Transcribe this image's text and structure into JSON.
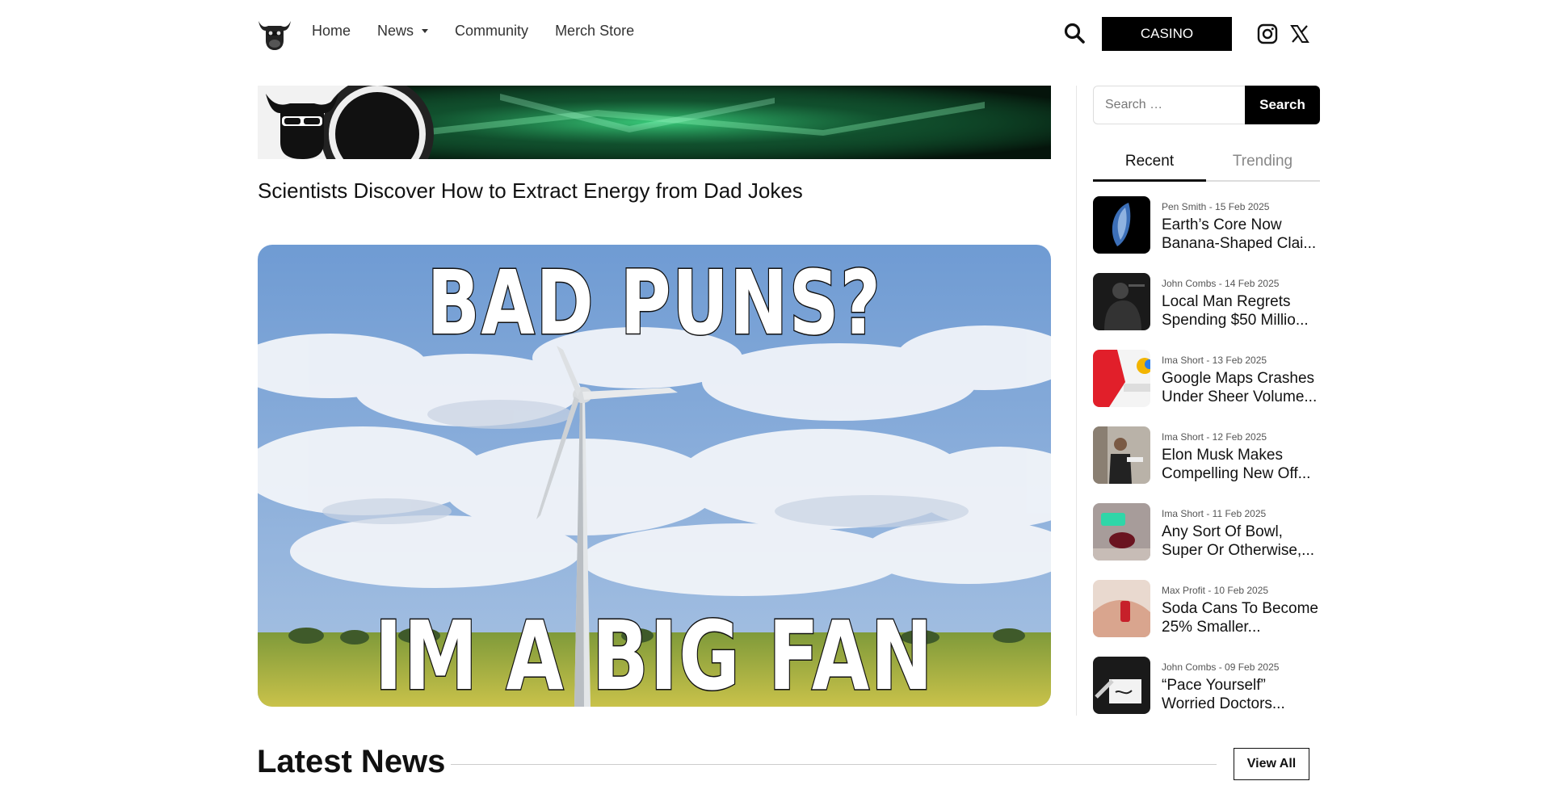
{
  "header": {
    "nav": [
      {
        "label": "Home"
      },
      {
        "label": "News"
      },
      {
        "label": "Community"
      },
      {
        "label": "Merch Store"
      }
    ],
    "casino_label": "CASINO",
    "icons": {
      "search": "search-icon",
      "instagram": "instagram-icon",
      "x": "x-icon",
      "logo": "bull-logo"
    }
  },
  "main": {
    "headline": "Scientists Discover How to Extract Energy from Dad Jokes",
    "hero_top": "BAD PUNS?",
    "hero_bottom": "IM A BIG FAN"
  },
  "sidebar": {
    "search_placeholder": "Search …",
    "search_button": "Search",
    "tabs": [
      {
        "label": "Recent"
      },
      {
        "label": "Trending"
      }
    ],
    "posts": [
      {
        "meta": "Pen Smith - 15 Feb 2025",
        "title": "Earth’s Core Now Banana-Shaped Clai..."
      },
      {
        "meta": "John Combs - 14 Feb 2025",
        "title": "Local Man Regrets Spending $50 Millio..."
      },
      {
        "meta": "Ima Short - 13 Feb 2025",
        "title": "Google Maps Crashes Under Sheer Volume..."
      },
      {
        "meta": "Ima Short - 12 Feb 2025",
        "title": "Elon Musk Makes Compelling New Off..."
      },
      {
        "meta": "Ima Short - 11 Feb 2025",
        "title": "Any Sort Of Bowl, Super Or Otherwise,..."
      },
      {
        "meta": "Max Profit - 10 Feb 2025",
        "title": "Soda Cans To Become 25% Smaller..."
      },
      {
        "meta": "John Combs - 09 Feb 2025",
        "title": "“Pace Yourself” Worried Doctors..."
      }
    ]
  },
  "latest": {
    "title": "Latest News",
    "view_all": "View All"
  },
  "colors": {
    "accent": "#000000",
    "banner_glow": "#3ddc84",
    "sky": "#7fa6d6"
  }
}
